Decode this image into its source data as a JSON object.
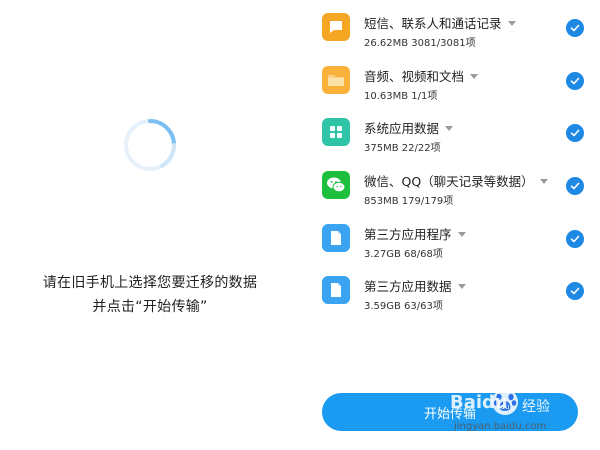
{
  "left": {
    "instruction_line1": "请在旧手机上选择您要迁移的数据",
    "instruction_line2": "并点击“开始传输”"
  },
  "items": [
    {
      "title": "短信、联系人和通话记录",
      "meta": "26.62MB  3081/3081项",
      "icon": "message-icon",
      "color": "#f5a623",
      "checked": true
    },
    {
      "title": "音频、视频和文档",
      "meta": "10.63MB  1/1项",
      "icon": "folder-icon",
      "color": "#f7b23b",
      "checked": true
    },
    {
      "title": "系统应用数据",
      "meta": "375MB  22/22项",
      "icon": "apps-grid-icon",
      "color": "#2ec4a5",
      "checked": true
    },
    {
      "title": "微信、QQ（聊天记录等数据）",
      "meta": "853MB  179/179项",
      "icon": "wechat-icon",
      "color": "#1fbf3e",
      "checked": true
    },
    {
      "title": "第三方应用程序",
      "meta": "3.27GB  68/68项",
      "icon": "file-icon",
      "color": "#3aa3f2",
      "checked": true
    },
    {
      "title": "第三方应用数据",
      "meta": "3.59GB  63/63项",
      "icon": "file-icon",
      "color": "#3aa3f2",
      "checked": true
    }
  ],
  "start_button_label": "开始传输",
  "watermark": {
    "brand": "Baidu",
    "suffix": "经验",
    "url": "jingyan.baidu.com"
  }
}
